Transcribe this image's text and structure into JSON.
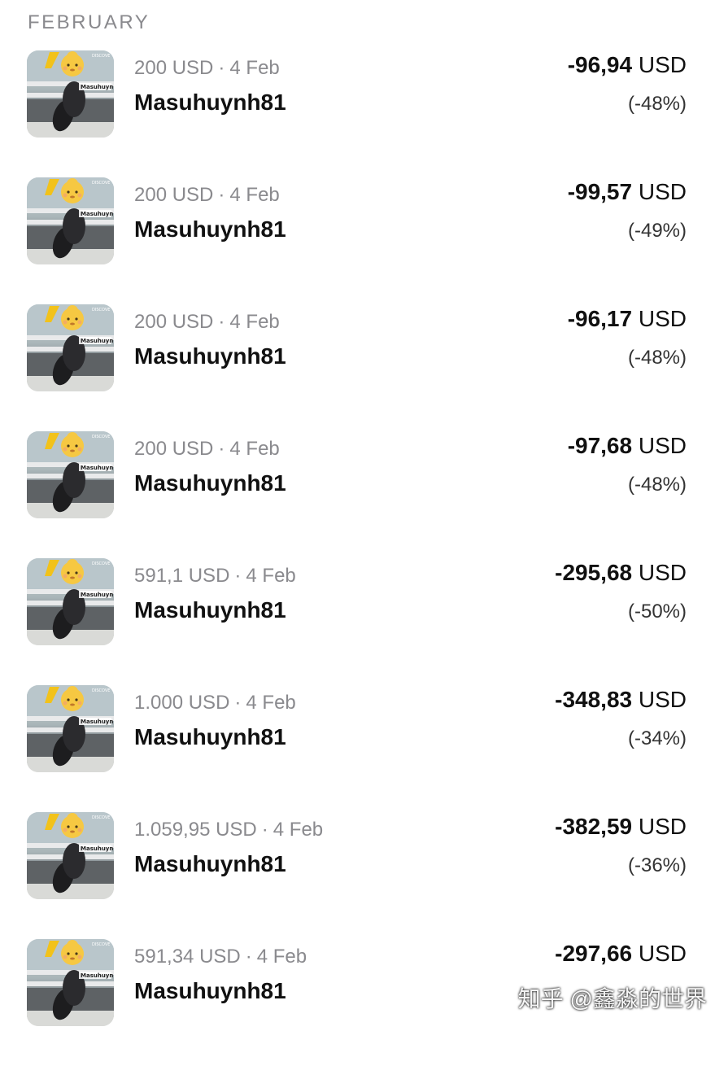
{
  "section": {
    "title": "FEBRUARY"
  },
  "transactions": [
    {
      "amount": "200 USD",
      "date": "4 Feb",
      "name": "Masuhuynh81",
      "change_value": "-96,94",
      "change_currency": "USD",
      "change_percent": "(-48%)"
    },
    {
      "amount": "200 USD",
      "date": "4 Feb",
      "name": "Masuhuynh81",
      "change_value": "-99,57",
      "change_currency": "USD",
      "change_percent": "(-49%)"
    },
    {
      "amount": "200 USD",
      "date": "4 Feb",
      "name": "Masuhuynh81",
      "change_value": "-96,17",
      "change_currency": "USD",
      "change_percent": "(-48%)"
    },
    {
      "amount": "200 USD",
      "date": "4 Feb",
      "name": "Masuhuynh81",
      "change_value": "-97,68",
      "change_currency": "USD",
      "change_percent": "(-48%)"
    },
    {
      "amount": "591,1 USD",
      "date": "4 Feb",
      "name": "Masuhuynh81",
      "change_value": "-295,68",
      "change_currency": "USD",
      "change_percent": "(-50%)"
    },
    {
      "amount": "1.000 USD",
      "date": "4 Feb",
      "name": "Masuhuynh81",
      "change_value": "-348,83",
      "change_currency": "USD",
      "change_percent": "(-34%)"
    },
    {
      "amount": "1.059,95 USD",
      "date": "4 Feb",
      "name": "Masuhuynh81",
      "change_value": "-382,59",
      "change_currency": "USD",
      "change_percent": "(-36%)"
    },
    {
      "amount": "591,34 USD",
      "date": "4 Feb",
      "name": "Masuhuynh81",
      "change_value": "-297,66",
      "change_currency": "USD",
      "change_percent": ""
    }
  ],
  "separator": "·",
  "icons": {
    "avatar": "motorcycle-rider-photo",
    "face": "baby-face-emoji"
  },
  "watermark": "知乎 @鑫淼的世界"
}
